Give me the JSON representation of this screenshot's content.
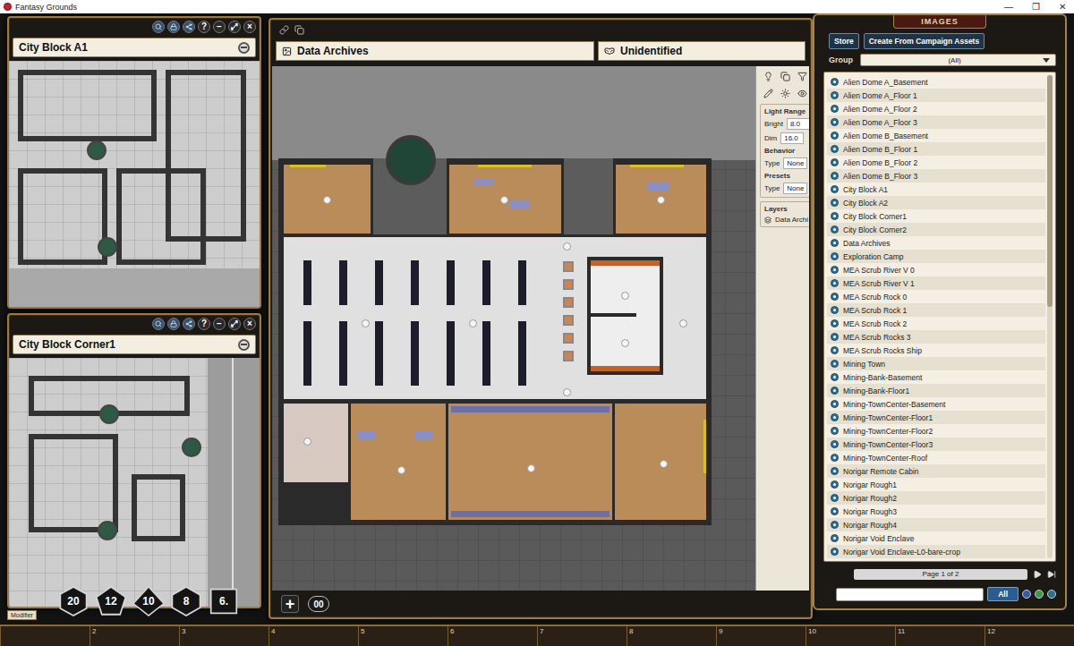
{
  "app": {
    "title": "Fantasy Grounds",
    "controls": [
      "—",
      "❐",
      "✕"
    ]
  },
  "map_windows": [
    {
      "title": "City Block A1",
      "controls": [
        "?",
        "−",
        "⤢",
        "×"
      ]
    },
    {
      "title": "City Block Corner1",
      "controls": [
        "?",
        "−",
        "⤢",
        "×"
      ]
    }
  ],
  "image_window": {
    "title": "Data Archives",
    "identity": "Unidentified",
    "settings": {
      "light_range": "Light Range",
      "bright_label": "Bright",
      "bright": "8.0",
      "dim_label": "Dim",
      "dim": "16.0",
      "behavior": "Behavior",
      "behavior_type_label": "Type",
      "behavior_type": "None",
      "presets": "Presets",
      "presets_type_label": "Type",
      "presets_type": "None",
      "layers": "Layers",
      "layer_items": [
        "Data Archi"
      ]
    },
    "add_button": "+",
    "percentile_die": "00"
  },
  "images_panel": {
    "title": "IMAGES",
    "buttons": [
      "Store",
      "Create From Campaign Assets"
    ],
    "group_label": "Group",
    "group": "(All)",
    "items": [
      "Alien Dome A_Basement",
      "Alien Dome A_Floor 1",
      "Alien Dome A_Floor 2",
      "Alien Dome A_Floor 3",
      "Alien Dome B_Basement",
      "Alien Dome B_Floor 1",
      "Alien Dome B_Floor 2",
      "Alien Dome B_Floor 3",
      "City Block A1",
      "City Block A2",
      "City Block Corner1",
      "City Block Corner2",
      "Data Archives",
      "Exploration Camp",
      "MEA Scrub River V 0",
      "MEA Scrub River V 1",
      "MEA Scrub Rock 0",
      "MEA Scrub Rock 1",
      "MEA Scrub Rock 2",
      "MEA Scrub Rocks 3",
      "MEA Scrub Rocks Ship",
      "Mining Town",
      "Mining-Bank-Basement",
      "Mining-Bank-Floor1",
      "Mining-TownCenter-Basement",
      "Mining-TownCenter-Floor1",
      "Mining-TownCenter-Floor2",
      "Mining-TownCenter-Floor3",
      "Mining-TownCenter-Roof",
      "Norigar Remote Cabin",
      "Norigar Rough1",
      "Norigar Rough2",
      "Norigar Rough3",
      "Norigar Rough4",
      "Norigar Void Enclave",
      "Norigar Void Enclave-L0-bare-crop"
    ],
    "page": "Page 1 of 2",
    "filter_button": "All"
  },
  "dice_tray": {
    "dice": [
      {
        "label": "20",
        "kind": "d20"
      },
      {
        "label": "12",
        "kind": "d12"
      },
      {
        "label": "10",
        "kind": "d10"
      },
      {
        "label": "8",
        "kind": "d8"
      },
      {
        "label": "6.",
        "kind": "d6"
      }
    ],
    "modifier": "Modifier"
  },
  "hotbar": {
    "slots": [
      "2",
      "3",
      "4",
      "5",
      "6",
      "7",
      "8",
      "9",
      "10",
      "11",
      "12"
    ]
  }
}
